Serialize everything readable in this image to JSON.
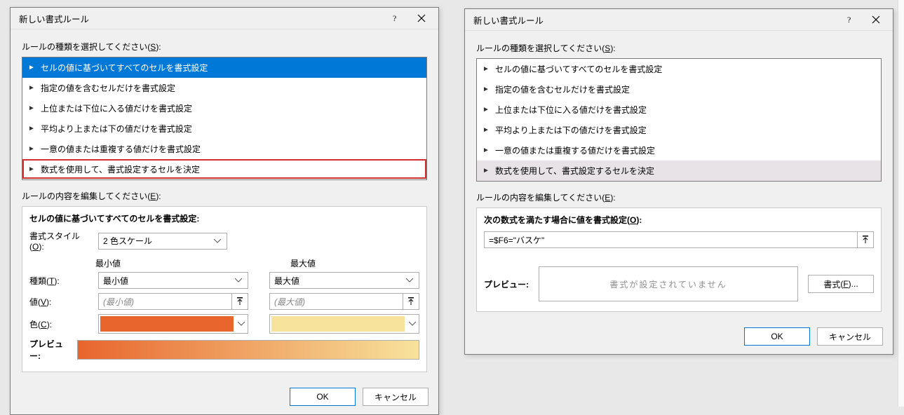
{
  "left": {
    "title": "新しい書式ルール",
    "lbl_select_rule": "ルールの種類を選択してください",
    "lbl_select_rule_ak": "S",
    "rule_types": [
      "セルの値に基づいてすべてのセルを書式設定",
      "指定の値を含むセルだけを書式設定",
      "上位または下位に入る値だけを書式設定",
      "平均より上または下の値だけを書式設定",
      "一意の値または重複する値だけを書式設定",
      "数式を使用して、書式設定するセルを決定"
    ],
    "lbl_edit_rule": "ルールの内容を編集してください",
    "lbl_edit_rule_ak": "E",
    "group_title": "セルの値に基づいてすべてのセルを書式設定:",
    "style_lbl": "書式スタイル",
    "style_ak": "O",
    "style_value": "2 色スケール",
    "min_head": "最小値",
    "max_head": "最大値",
    "type_lbl": "種類",
    "type_ak": "T",
    "type_min_value": "最小値",
    "type_max_value": "最大値",
    "value_lbl": "値",
    "value_ak": "V",
    "value_min_ph": "(最小値)",
    "value_max_ph": "(最大値)",
    "color_lbl": "色",
    "color_ak": "C",
    "preview_lbl": "プレビュー:",
    "ok": "OK",
    "cancel": "キャンセル"
  },
  "right": {
    "title": "新しい書式ルール",
    "lbl_select_rule": "ルールの種類を選択してください",
    "lbl_select_rule_ak": "S",
    "rule_types": [
      "セルの値に基づいてすべてのセルを書式設定",
      "指定の値を含むセルだけを書式設定",
      "上位または下位に入る値だけを書式設定",
      "平均より上または下の値だけを書式設定",
      "一意の値または重複する値だけを書式設定",
      "数式を使用して、書式設定するセルを決定"
    ],
    "lbl_edit_rule": "ルールの内容を編集してください",
    "lbl_edit_rule_ak": "E",
    "group_title": "次の数式を満たす場合に値を書式設定",
    "group_title_ak": "O",
    "formula_value": "=$F6=\"バスケ\"",
    "preview_lbl": "プレビュー:",
    "preview_empty": "書式が設定されていません",
    "format_btn": "書式",
    "format_ak": "F",
    "ok": "OK",
    "cancel": "キャンセル"
  }
}
